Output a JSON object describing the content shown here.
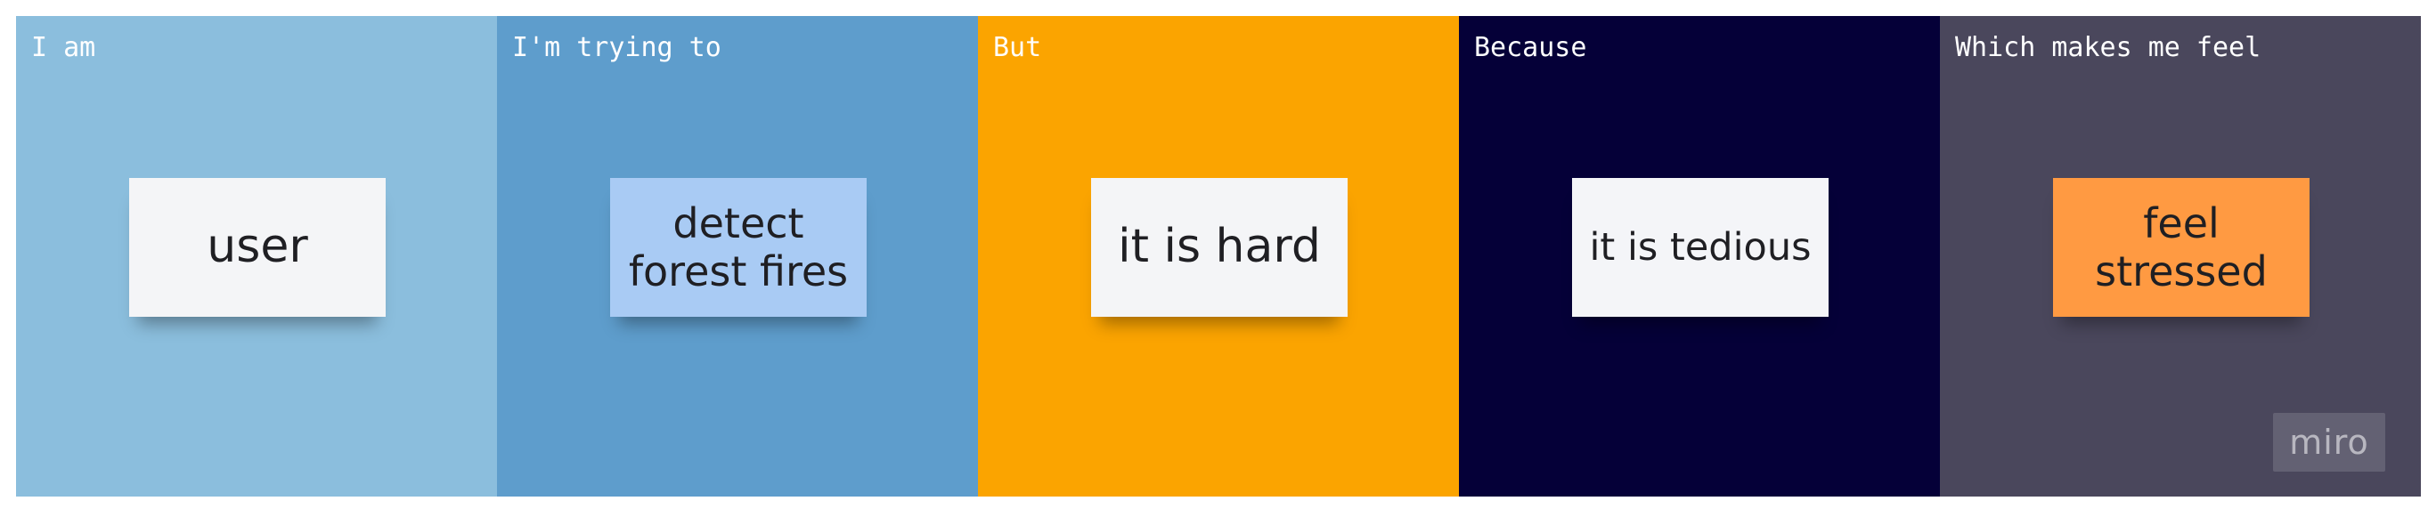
{
  "panels": [
    {
      "label": "I am",
      "sticky": "user",
      "bg": "#8bbedd",
      "sticky_bg": "#f4f5f7"
    },
    {
      "label": "I'm trying to",
      "sticky": "detect\nforest fires",
      "bg": "#5e9dcc",
      "sticky_bg": "#a9cbf4"
    },
    {
      "label": "But",
      "sticky": "it is hard",
      "bg": "#fba400",
      "sticky_bg": "#f4f5f7"
    },
    {
      "label": "Because",
      "sticky": "it is tedious",
      "bg": "#050038",
      "sticky_bg": "#f4f5f8"
    },
    {
      "label": "Which makes me feel",
      "sticky": "feel\nstressed",
      "bg": "#4a475c",
      "sticky_bg": "#ff9a42"
    }
  ],
  "logo": {
    "text": "miro"
  }
}
